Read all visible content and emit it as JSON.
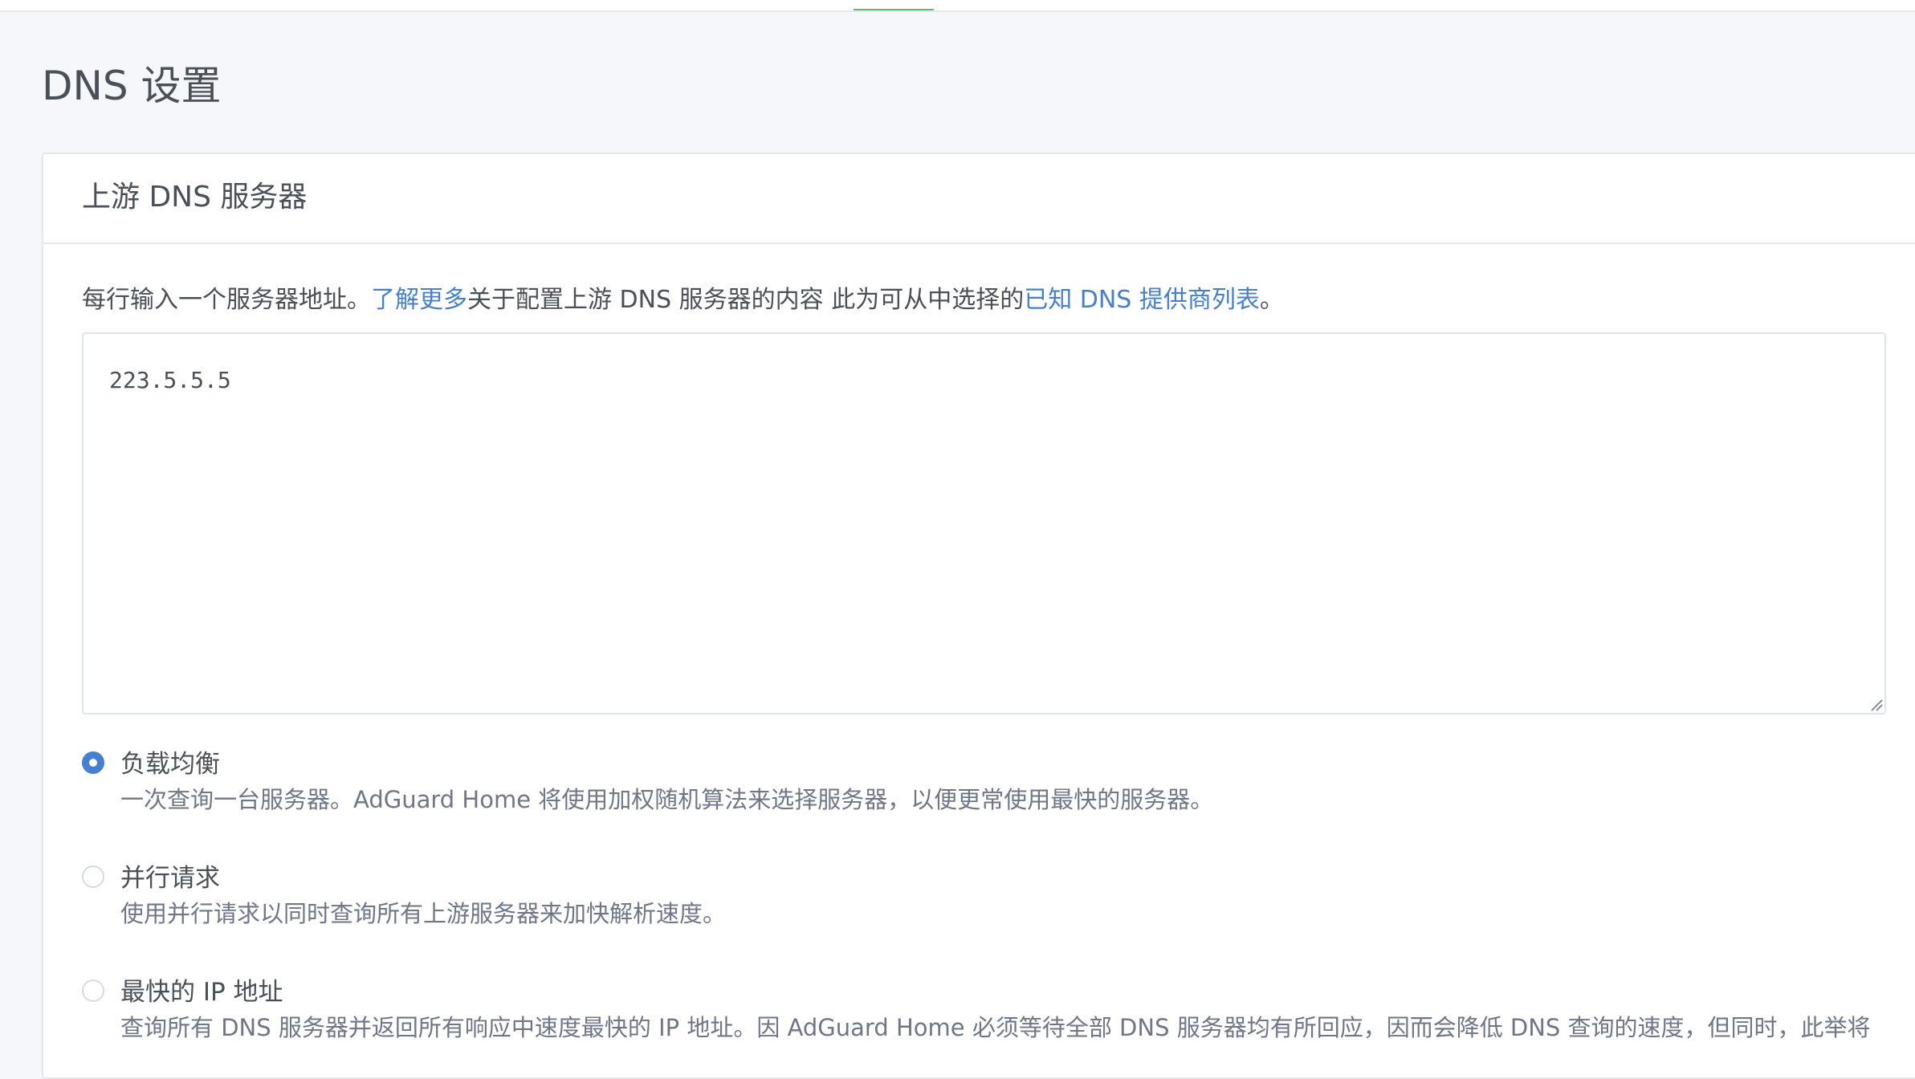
{
  "page": {
    "title": "DNS 设置"
  },
  "upstream_card": {
    "title": "上游 DNS 服务器",
    "help": {
      "part1": "每行输入一个服务器地址。",
      "link1": "了解更多",
      "part2": "关于配置上游 DNS 服务器的内容 此为可从中选择的",
      "link2": "已知 DNS 提供商列表",
      "part3": "。"
    },
    "upstream_servers_value": "223.5.5.5",
    "modes": [
      {
        "label": "负载均衡",
        "description": "一次查询一台服务器。AdGuard Home 将使用加权随机算法来选择服务器，以便更常使用最快的服务器。",
        "selected": true
      },
      {
        "label": "并行请求",
        "description": "使用并行请求以同时查询所有上游服务器来加快解析速度。",
        "selected": false
      },
      {
        "label": "最快的 IP 地址",
        "description": "查询所有 DNS 服务器并返回所有响应中速度最快的 IP 地址。因 AdGuard Home 必须等待全部 DNS 服务器均有所回应，因而会降低 DNS 查询的速度，但同时，此举将",
        "selected": false
      }
    ]
  },
  "colors": {
    "accent": "#467fcf",
    "active_tab_underline": "#66b574",
    "page_background": "#f5f7fb"
  }
}
